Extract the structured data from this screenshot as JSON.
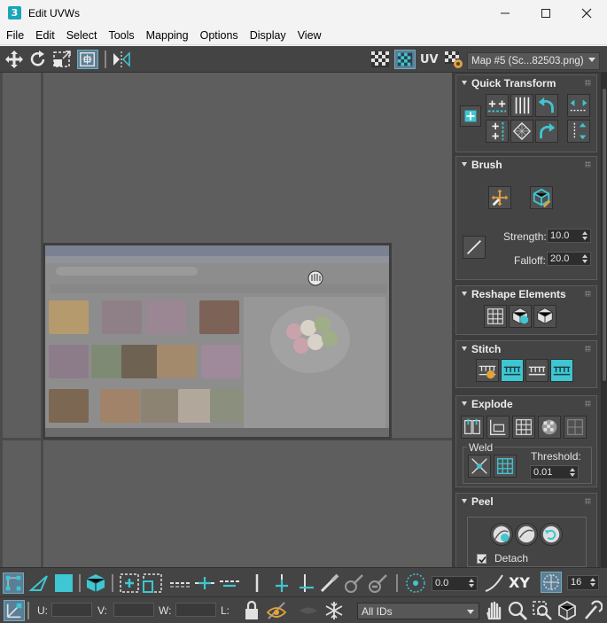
{
  "window": {
    "app_icon": "3",
    "title": "Edit UVWs"
  },
  "menu": [
    "File",
    "Edit",
    "Select",
    "Tools",
    "Mapping",
    "Options",
    "Display",
    "View"
  ],
  "toolbar_top": {
    "uv_label": "UV",
    "map_dropdown": "Map #5 (Sc...82503.png)"
  },
  "panel": {
    "quick_transform": {
      "title": "Quick Transform"
    },
    "brush": {
      "title": "Brush",
      "strength_label": "Strength:",
      "strength_value": "10.0",
      "falloff_label": "Falloff:",
      "falloff_value": "20.0"
    },
    "reshape": {
      "title": "Reshape Elements"
    },
    "stitch": {
      "title": "Stitch"
    },
    "explode": {
      "title": "Explode",
      "weld_label": "Weld",
      "threshold_label": "Threshold:",
      "threshold_value": "0.01"
    },
    "peel": {
      "title": "Peel",
      "detach_label": "Detach",
      "detach_checked": true
    }
  },
  "bottom1": {
    "angle_value": "0.0",
    "xy_label": "XY",
    "count_value": "16"
  },
  "bottom2": {
    "u_label": "U:",
    "v_label": "V:",
    "w_label": "W:",
    "l_label": "L:",
    "ids_dropdown": "All IDs"
  },
  "colors": {
    "accent": "#3ec6d2",
    "toolbar_bg": "#444444",
    "viewport_bg": "#5e5e5e"
  }
}
